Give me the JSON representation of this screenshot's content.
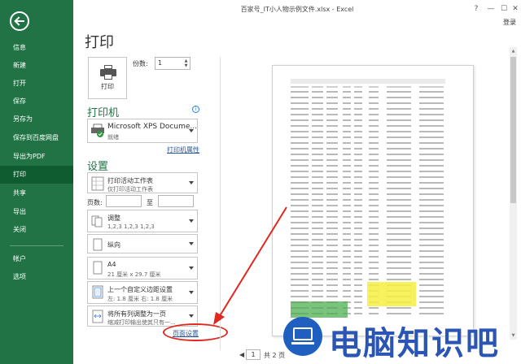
{
  "window": {
    "title": "百家号_IT小人物示例文件.xlsx - Excel",
    "login": "登录"
  },
  "nav": {
    "items": [
      "信息",
      "新建",
      "打开",
      "保存",
      "另存为",
      "保存到百度网盘",
      "导出为PDF",
      "打印",
      "共享",
      "导出",
      "关闭",
      "帐户",
      "选项"
    ],
    "active": "打印"
  },
  "print": {
    "heading": "打印",
    "print_button": "打印",
    "copies_label": "份数:",
    "copies_value": "1"
  },
  "printer": {
    "heading": "打印机",
    "name": "Microsoft XPS Docume...",
    "status": "就绪",
    "properties_link": "打印机属性"
  },
  "settings": {
    "heading": "设置",
    "scope": {
      "title": "打印活动工作表",
      "sub": "仅打印活动工作表"
    },
    "pages_label": "页数:",
    "to_label": "至",
    "collate": {
      "title": "调整",
      "sub": "1,2,3   1,2,3   1,2,3"
    },
    "orientation": {
      "title": "纵向"
    },
    "paper": {
      "title": "A4",
      "sub": "21 厘米 x 29.7 厘米"
    },
    "margins": {
      "title": "上一个自定义边距设置",
      "sub": "左: 1.8 厘米   右: 1.8 厘米"
    },
    "scaling": {
      "title": "将所有列调整为一页",
      "sub": "缩减打印输出使其只有一..."
    },
    "page_setup_link": "页面设置"
  },
  "pager": {
    "current": "1",
    "total": "共 2 页"
  },
  "watermark": {
    "text": "电脑知识吧"
  },
  "colors": {
    "nav_bg": "#217346",
    "accent": "#217346",
    "link": "#2b579a",
    "annotation": "#e0281e"
  }
}
